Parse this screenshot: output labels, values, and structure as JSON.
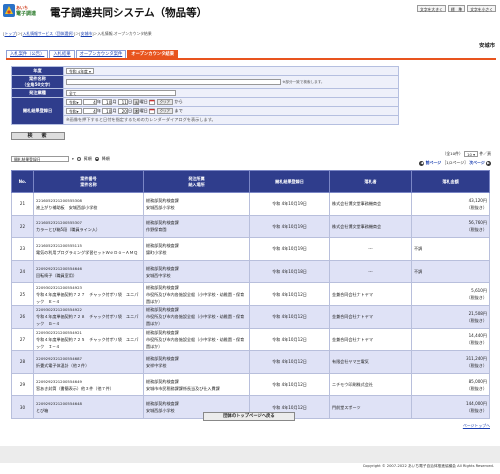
{
  "header": {
    "logo_line1": "あいち",
    "logo_line2": "電子調達",
    "title": "電子調達共同システム（物品等）",
    "font_buttons": [
      "文字を大きく",
      "標　準",
      "文字を小さく"
    ]
  },
  "breadcrumb": {
    "links": [
      "トップ",
      "入札情報サービス（団体選択）",
      "安城市"
    ],
    "current": "入札情報-オープンカウンタ結果"
  },
  "city": "安城市",
  "tabs": [
    "入札案件（公告）",
    "入札結果",
    "オープンカウンタ案件",
    "オープンカウンタ結果"
  ],
  "search": {
    "year_label": "年度",
    "year_value": "令和 4年度",
    "case_name_label": "案件名称",
    "case_name_note": "（全角50文字）",
    "partial_match_note": "※部分一致で検索します。",
    "category_label": "発注業種",
    "category_value": "全て",
    "date_label": "開札結果登録日",
    "era": "令和",
    "from": {
      "year": "4",
      "month": "10",
      "day": "11",
      "weekday": "火"
    },
    "to": {
      "year": "4",
      "month": "10",
      "day": "20",
      "weekday": "木"
    },
    "year_unit": "年",
    "month_unit": "月",
    "day_unit": "日",
    "weekday_suffix": "曜日",
    "clear_label": "クリア",
    "kara": "から",
    "made": "まで",
    "calendar_note": "※画像を押下すると日付を指定するためのカレンダーダイアログを表示します。",
    "search_button": "検　索"
  },
  "sort": {
    "field": "開札結果登録日",
    "asc_label": "昇順",
    "desc_label": "降順",
    "selected": "desc"
  },
  "pager": {
    "total_label": "（全10件）",
    "page_size": "10",
    "page_size_suffix": "件／頁",
    "prev_label": "前ページ",
    "range_label": "［1/2ページ］",
    "next_label": "次ページ"
  },
  "table": {
    "headers": {
      "no": "No.",
      "case": [
        "案件番号",
        "案件名称"
      ],
      "dept": [
        "発注所属",
        "納入場所"
      ],
      "date": "開札結果登録日",
      "winner": "落札者",
      "amount": "落札金額"
    },
    "rows": [
      {
        "no": "21",
        "case_no": "2216052321200555308",
        "case_name": "液上がり補助板　安城西部小学校",
        "dept": "総務部契約検査課",
        "place": "安城西部小学校",
        "date": "令和 4年10月19日",
        "winner": "株式会社博文堂事務機商会",
        "amount": "43,120円",
        "tax": "（税抜き）"
      },
      {
        "no": "22",
        "case_no": "2216052321200555307",
        "case_name": "カラーとび箱5段（職員ライン入）",
        "dept": "総務部契約検査課",
        "place": "作野保育園",
        "date": "令和 4年10月19日",
        "winner": "株式会社博文堂事務機商会",
        "amount": "56,760円",
        "tax": "（税抜き）"
      },
      {
        "no": "23",
        "case_no": "2216052321200555115",
        "case_name": "電気の利用プログラミング学習セットＷｅＤｏ−ＡＭＱ",
        "dept": "総務部契約検査課",
        "place": "錦町小学校",
        "date": "令和 4年10月19日",
        "winner": "---",
        "amount": "不調",
        "tax": ""
      },
      {
        "no": "24",
        "case_no": "2209292321200554646",
        "case_name": "回転椅子（職員室用）",
        "dept": "総務部契約検査課",
        "place": "安城西中学校",
        "date": "令和 4年10月18日",
        "winner": "---",
        "amount": "不調",
        "tax": ""
      },
      {
        "no": "25",
        "case_no": "2209302321200554923",
        "case_name": "令和４年度単価契約７２７　チャック付ポリ袋　ユニパック　Ｅ−４",
        "dept": "総務部契約検査課",
        "place": "市役所及び市内各施設全般（小中学校・幼稚園・保育園ほか）",
        "date": "令和 4年10月12日",
        "winner": "金兼合同会社ナトヤマ",
        "amount": "5,610円",
        "tax": "（税抜き）"
      },
      {
        "no": "26",
        "case_no": "2209302321200554922",
        "case_name": "令和４年度単価契約７２８　チャック付ポリ袋　ユニパック　Ｇ−４",
        "dept": "総務部契約検査課",
        "place": "市役所及び市内各施設全般（小中学校・幼稚園・保育園ほか）",
        "date": "令和 4年10月12日",
        "winner": "金兼合同会社ナトヤマ",
        "amount": "21,508円",
        "tax": "（税抜き）"
      },
      {
        "no": "27",
        "case_no": "2209302321200554921",
        "case_name": "令和４年度単価契約７２５　チャック付ポリ袋　ユニパック　Ｉ−４",
        "dept": "総務部契約検査課",
        "place": "市役所及び市内各施設全般（小中学校・幼稚園・保育園ほか）",
        "date": "令和 4年10月12日",
        "winner": "金兼合同会社ナトヤマ",
        "amount": "14,440円",
        "tax": "（税抜き）"
      },
      {
        "no": "28",
        "case_no": "2209292321200554687",
        "case_name": "折畳式電子体温計（他２件）",
        "dept": "総務部契約検査課",
        "place": "安祥中学校",
        "date": "令和 4年10月12日",
        "winner": "有限会社ヤマ三電気",
        "amount": "311,240円",
        "tax": "（税抜き）"
      },
      {
        "no": "29",
        "case_no": "2209292321200554649",
        "case_name": "窓あき封筒（書簡表示）他３件（他７件）",
        "dept": "総務部契約検査課",
        "place": "安城市市民税務課課係長当及び仕入費課",
        "date": "令和 4年10月12日",
        "winner": "ニチモウ印刷株式会社",
        "amount": "85,000円",
        "tax": "（税抜き）"
      },
      {
        "no": "30",
        "case_no": "2209292321200554648",
        "case_name": "とび箱",
        "dept": "総務部契約検査課",
        "place": "安城西部小学校",
        "date": "令和 4年10月12日",
        "winner": "門前堂スポーツ",
        "amount": "144,000円",
        "tax": "（税抜き）"
      }
    ]
  },
  "back_button": "団体のトップページへ戻る",
  "page_top_link": "ページトップへ",
  "copyright": "Copyright © 2007-2022 あいち電子自治体推進協議会 All Rights Reserved."
}
